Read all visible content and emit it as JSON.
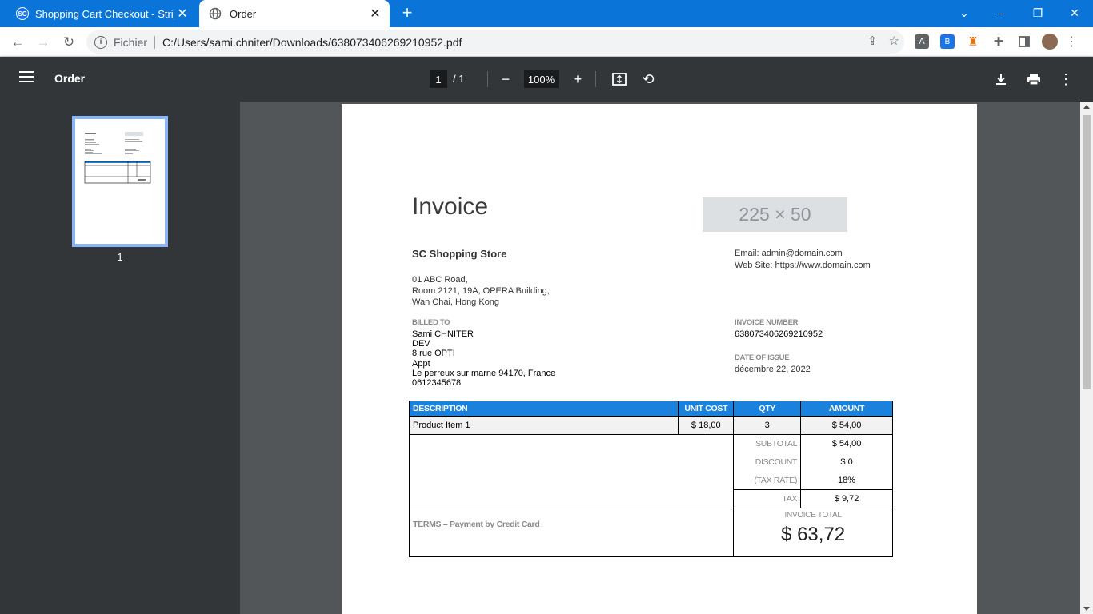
{
  "browser": {
    "tabs": [
      {
        "title": "Shopping Cart Checkout - Stripe",
        "favicon": "SC"
      },
      {
        "title": "Order"
      }
    ],
    "address": {
      "scheme_label": "Fichier",
      "url": "C:/Users/sami.chniter/Downloads/638073406269210952.pdf"
    }
  },
  "pdf_viewer": {
    "title": "Order",
    "page_current": "1",
    "page_total": "/  1",
    "zoom": "100%",
    "thumbnail_label": "1"
  },
  "invoice": {
    "heading": "Invoice",
    "logo_placeholder": "225 × 50",
    "store_name": "SC Shopping Store",
    "email": "Email: admin@domain.com",
    "website": "Web Site: https://www.domain.com",
    "address_lines": [
      "01 ABC Road,",
      "Room 2121, 19A, OPERA Building,",
      "Wan Chai, Hong Kong"
    ],
    "billed_to_label": "BILLED TO",
    "billed_to_lines": [
      "Sami CHNITER",
      "DEV",
      "8 rue OPTI",
      "Appt",
      "Le perreux sur marne 94170, France",
      "0612345678"
    ],
    "invoice_number_label": "INVOICE NUMBER",
    "invoice_number": "638073406269210952",
    "date_label": "DATE OF ISSUE",
    "date": "décembre 22, 2022",
    "table_headers": {
      "description": "DESCRIPTION",
      "unit_cost": "UNIT COST",
      "qty": "QTY",
      "amount": "AMOUNT"
    },
    "items": [
      {
        "description": "Product Item 1",
        "unit_cost": "$ 18,00",
        "qty": "3",
        "amount": "$ 54,00"
      }
    ],
    "subtotal_label": "SUBTOTAL",
    "subtotal": "$ 54,00",
    "discount_label": "DISCOUNT",
    "discount": "$ 0",
    "tax_rate_label": "(TAX RATE)",
    "tax_rate": "18%",
    "tax_label": "TAX",
    "tax": "$ 9,72",
    "terms": "TERMS – Payment by Credit Card",
    "total_label": "INVOICE TOTAL",
    "total": "$ 63,72"
  },
  "colors": {
    "tabbar": "#0b74d8",
    "pdf_toolbar": "#323639",
    "table_header": "#1a82dd",
    "thumbnail_border": "#8ab4f8"
  }
}
